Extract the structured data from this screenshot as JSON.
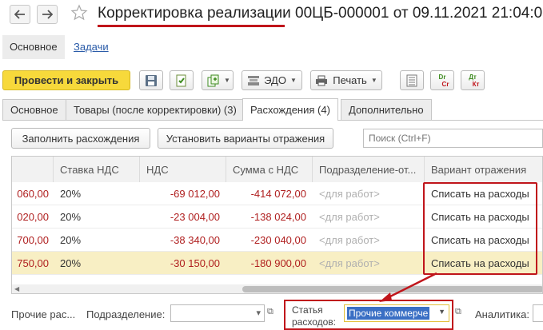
{
  "window": {
    "title": "Корректировка реализации 00ЦБ-000001 от 09.11.2021 21:04:0"
  },
  "nav": {
    "main_link": "Основное",
    "tasks_link": "Задачи"
  },
  "toolbar": {
    "post_close": "Провести и закрыть",
    "edo": "ЭДО",
    "print": "Печать",
    "dt_kt_top": "Дт",
    "dt_kt_bottom": "Кт",
    "dr_cr_top": "Dr",
    "dr_cr_bottom": "Cr"
  },
  "tabs": [
    {
      "label": "Основное"
    },
    {
      "label": "Товары (после корректировки) (3)"
    },
    {
      "label": "Расхождения (4)"
    },
    {
      "label": "Дополнительно"
    }
  ],
  "actions": {
    "fill": "Заполнить расхождения",
    "set_variants": "Установить варианты отражения",
    "search_placeholder": "Поиск (Ctrl+F)"
  },
  "table": {
    "headers": [
      "",
      "Ставка НДС",
      "НДС",
      "Сумма с НДС",
      "Подразделение-от...",
      "Вариант отражения"
    ],
    "rows": [
      {
        "amount": "060,00",
        "vat_rate": "20%",
        "vat": "-69 012,00",
        "sum": "-414 072,00",
        "dept": "<для работ>",
        "variant": "Списать на расходы"
      },
      {
        "amount": "020,00",
        "vat_rate": "20%",
        "vat": "-23 004,00",
        "sum": "-138 024,00",
        "dept": "<для работ>",
        "variant": "Списать на расходы"
      },
      {
        "amount": "700,00",
        "vat_rate": "20%",
        "vat": "-38 340,00",
        "sum": "-230 040,00",
        "dept": "<для работ>",
        "variant": "Списать на расходы"
      },
      {
        "amount": "750,00",
        "vat_rate": "20%",
        "vat": "-30 150,00",
        "sum": "-180 900,00",
        "dept": "<для работ>",
        "variant": "Списать на расходы"
      }
    ]
  },
  "bottom": {
    "other_label": "Прочие рас...",
    "dept_label": "Подразделение:",
    "article_label_1": "Статья",
    "article_label_2": "расходов:",
    "article_value": "Прочие коммерче",
    "analytics_label": "Аналитика:"
  },
  "colors": {
    "accent_yellow": "#f7d93b",
    "annotation_red": "#c0151b",
    "negative_text": "#b02020",
    "selected_row": "#f8efc4"
  }
}
